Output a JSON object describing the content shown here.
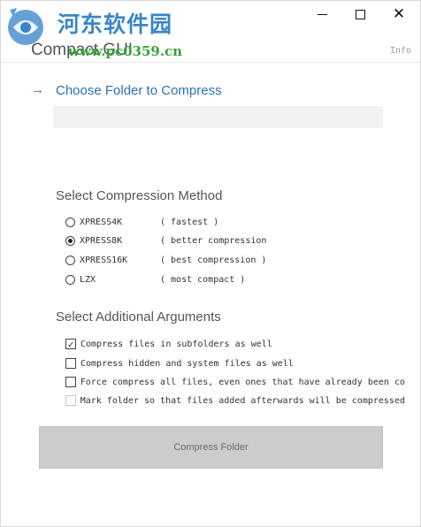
{
  "watermark": {
    "site_name": "河东软件园",
    "site_url": "www.pc0359.cn"
  },
  "window": {
    "title": "Compact GUI",
    "minimize_glyph": "—",
    "maximize_glyph": "☐",
    "close_glyph": "✕",
    "info_label": "Info"
  },
  "folder": {
    "arrow_glyph": "→",
    "choose_label": "Choose Folder to Compress",
    "path_value": ""
  },
  "compression": {
    "section_title": "Select Compression Method",
    "options": [
      {
        "name": "XPRESS4K",
        "desc": "( fastest )",
        "selected": false
      },
      {
        "name": "XPRESS8K",
        "desc": "( better compression",
        "selected": true
      },
      {
        "name": "XPRESS16K",
        "desc": "( best compression )",
        "selected": false
      },
      {
        "name": "LZX",
        "desc": "( most compact )",
        "selected": false
      }
    ]
  },
  "arguments": {
    "section_title": "Select Additional Arguments",
    "items": [
      {
        "label": "Compress files in subfolders as well",
        "checked": true,
        "enabled": true
      },
      {
        "label": "Compress hidden and system files as well",
        "checked": false,
        "enabled": true
      },
      {
        "label": "Force compress all files, even ones that have already been co",
        "checked": false,
        "enabled": true
      },
      {
        "label": "Mark folder so that files added afterwards will be compressed",
        "checked": false,
        "enabled": false
      }
    ],
    "check_glyph": "✓"
  },
  "actions": {
    "compress_label": "Compress Folder"
  },
  "colors": {
    "accent": "#2f6fb4",
    "watermark_blue": "#3a86c8",
    "watermark_green": "#36a33c",
    "button_disabled_bg": "#cccccc",
    "field_bg": "#f2f2f2"
  }
}
